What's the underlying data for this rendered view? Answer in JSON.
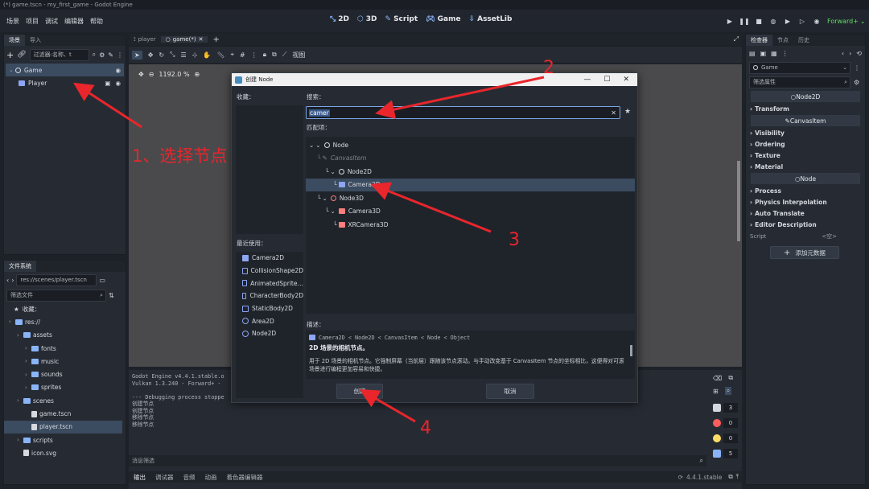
{
  "window": {
    "title": "(*) game.tscn - my_first_game - Godot Engine"
  },
  "menu": [
    "场景",
    "项目",
    "调试",
    "编辑器",
    "帮助"
  ],
  "workspaces": [
    {
      "icon": "2d-icon",
      "label": "2D"
    },
    {
      "icon": "3d-icon",
      "label": "3D"
    },
    {
      "icon": "script-icon",
      "label": "Script"
    },
    {
      "icon": "game-icon",
      "label": "Game"
    },
    {
      "icon": "assetlib-icon",
      "label": "AssetLib"
    }
  ],
  "renderer": "Forward+",
  "scene_dock": {
    "tabs": [
      "场景",
      "导入"
    ],
    "filter_placeholder": "过滤器:名称、t",
    "nodes": [
      {
        "name": "Game",
        "type": "Node",
        "selected": true
      },
      {
        "name": "Player",
        "type": "CharacterBody2D",
        "selected": false
      }
    ]
  },
  "filesystem": {
    "tab": "文件系统",
    "path": "res://scenes/player.tscn",
    "filter_placeholder": "筛选文件",
    "favorites": "收藏：",
    "items": [
      {
        "label": "res://",
        "kind": "folder",
        "depth": 0
      },
      {
        "label": "assets",
        "kind": "folder",
        "depth": 1
      },
      {
        "label": "fonts",
        "kind": "folder",
        "depth": 2
      },
      {
        "label": "music",
        "kind": "folder",
        "depth": 2
      },
      {
        "label": "sounds",
        "kind": "folder",
        "depth": 2
      },
      {
        "label": "sprites",
        "kind": "folder",
        "depth": 2
      },
      {
        "label": "scenes",
        "kind": "folder",
        "depth": 1
      },
      {
        "label": "game.tscn",
        "kind": "file",
        "depth": 2
      },
      {
        "label": "player.tscn",
        "kind": "file",
        "depth": 2,
        "selected": true
      },
      {
        "label": "scripts",
        "kind": "folder",
        "depth": 1
      },
      {
        "label": "icon.svg",
        "kind": "file",
        "depth": 1
      }
    ]
  },
  "editor_tabs": [
    {
      "label": "player",
      "active": false
    },
    {
      "label": "game(*)",
      "active": true
    }
  ],
  "toolbar": {
    "view_label": "视图"
  },
  "zoom": "1192.0 %",
  "dialog": {
    "title": "创建 Node",
    "favorites_label": "收藏：",
    "search_label": "搜索：",
    "search_value": "camer",
    "matches_label": "匹配项：",
    "recent_label": "最近使用：",
    "recent": [
      {
        "label": "Camera2D",
        "icon": "camera2d-icon"
      },
      {
        "label": "CollisionShape2D",
        "icon": "collisionshape2d-icon"
      },
      {
        "label": "AnimatedSprite…",
        "icon": "animatedsprite2d-icon"
      },
      {
        "label": "CharacterBody2D",
        "icon": "characterbody2d-icon"
      },
      {
        "label": "StaticBody2D",
        "icon": "staticbody2d-icon"
      },
      {
        "label": "Area2D",
        "icon": "area2d-icon"
      },
      {
        "label": "Node2D",
        "icon": "node2d-icon"
      }
    ],
    "tree": [
      {
        "label": "Node",
        "depth": 0,
        "icon": "node-icon",
        "dim": false,
        "selected": false
      },
      {
        "label": "CanvasItem",
        "depth": 1,
        "icon": "canvasitem-icon",
        "dim": true,
        "selected": false
      },
      {
        "label": "Node2D",
        "depth": 2,
        "icon": "node2d-icon",
        "dim": false,
        "selected": false
      },
      {
        "label": "Camera2D",
        "depth": 3,
        "icon": "camera2d-icon",
        "dim": false,
        "selected": true
      },
      {
        "label": "Node3D",
        "depth": 1,
        "icon": "node3d-icon",
        "dim": false,
        "selected": false
      },
      {
        "label": "Camera3D",
        "depth": 2,
        "icon": "camera3d-icon",
        "dim": false,
        "selected": false
      },
      {
        "label": "XRCamera3D",
        "depth": 3,
        "icon": "xrcamera3d-icon",
        "dim": false,
        "selected": false
      }
    ],
    "description_label": "描述：",
    "description_path": "Camera2D < Node2D < CanvasItem < Node < Object",
    "description_title": "2D 场景的相机节点。",
    "description_text": "用于 2D 场景的相机节点。它强制屏幕（当前层）跟随该节点滚动。与手动改变基于 CanvasItem 节点的坐标相比，这便得对可滚场景进行编程更加容易和快捷。",
    "create_button": "创建",
    "cancel_button": "取消"
  },
  "inspector": {
    "tabs": [
      "检查器",
      "节点",
      "历史"
    ],
    "object": "Game",
    "filter_placeholder": "筛选属性",
    "sections": [
      {
        "kind": "header",
        "label": "Node2D"
      },
      {
        "kind": "section",
        "label": "Transform"
      },
      {
        "kind": "header",
        "label": "CanvasItem"
      },
      {
        "kind": "section",
        "label": "Visibility"
      },
      {
        "kind": "section",
        "label": "Ordering"
      },
      {
        "kind": "section",
        "label": "Texture"
      },
      {
        "kind": "section",
        "label": "Material"
      },
      {
        "kind": "header",
        "label": "Node"
      },
      {
        "kind": "section",
        "label": "Process"
      },
      {
        "kind": "section",
        "label": "Physics Interpolation"
      },
      {
        "kind": "section",
        "label": "Auto Translate"
      },
      {
        "kind": "section",
        "label": "Editor Description"
      }
    ],
    "script_label": "Script",
    "script_value": "<空>",
    "add_metadata": "添加元数据"
  },
  "output": {
    "lines": [
      "Godot Engine v4.4.1.stable.o",
      "Vulkan 1.3.240 - Forward+ -",
      "",
      "--- Debugging process stoppe",
      "创建节点",
      "创建节点",
      "移除节点",
      "移除节点"
    ],
    "filter_placeholder": "消息筛选",
    "counts": {
      "log": "3",
      "error": "0",
      "warning": "0",
      "info": "5"
    }
  },
  "bottom_tabs": [
    "输出",
    "调试器",
    "音频",
    "动画",
    "着色器编辑器"
  ],
  "version": "4.4.1.stable",
  "annotations": {
    "step1": "1、选择节点",
    "step2": "2",
    "step3": "3",
    "step4": "4"
  },
  "colors": {
    "accent": "#8ab4f8",
    "annotation": "#e8262c",
    "selection": "#3b4b60"
  }
}
